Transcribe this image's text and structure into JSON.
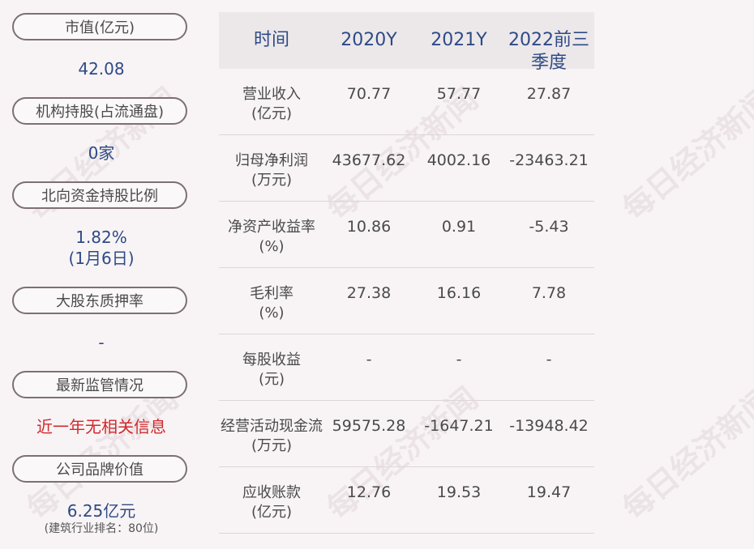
{
  "left": {
    "market_cap_label": "市值(亿元)",
    "market_cap_value": "42.08",
    "inst_label": "机构持股(占流通盘)",
    "inst_value": "0家",
    "north_label": "北向资金持股比例",
    "north_value": "1.82%",
    "north_date": "(1月6日)",
    "pledge_label": "大股东质押率",
    "pledge_value": "-",
    "reg_label": "最新监管情况",
    "reg_value": "近一年无相关信息",
    "brand_label": "公司品牌价值",
    "brand_value": "6.25亿元",
    "brand_rank": "(建筑行业排名：80位)"
  },
  "table": {
    "headers": [
      "时间",
      "2020Y",
      "2021Y",
      "2022前三",
      "季度"
    ],
    "rows": [
      {
        "label1": "营业收入",
        "label2": "(亿元)",
        "v": [
          "70.77",
          "57.77",
          "27.87"
        ]
      },
      {
        "label1": "归母净利润",
        "label2": "(万元)",
        "v": [
          "43677.62",
          "4002.16",
          "-23463.21"
        ]
      },
      {
        "label1": "净资产收益率",
        "label2": "(%)",
        "v": [
          "10.86",
          "0.91",
          "-5.43"
        ]
      },
      {
        "label1": "毛利率",
        "label2": "(%)",
        "v": [
          "27.38",
          "16.16",
          "7.78"
        ]
      },
      {
        "label1": "每股收益",
        "label2": "(元)",
        "v": [
          "-",
          "-",
          "-"
        ]
      },
      {
        "label1": "经营活动现金流",
        "label2": "(万元)",
        "v": [
          "59575.28",
          "-1647.21",
          "-13948.42"
        ]
      },
      {
        "label1": "应收账款",
        "label2": "(亿元)",
        "v": [
          "12.76",
          "19.53",
          "19.47"
        ]
      }
    ]
  },
  "watermark": "每日经济新闻"
}
